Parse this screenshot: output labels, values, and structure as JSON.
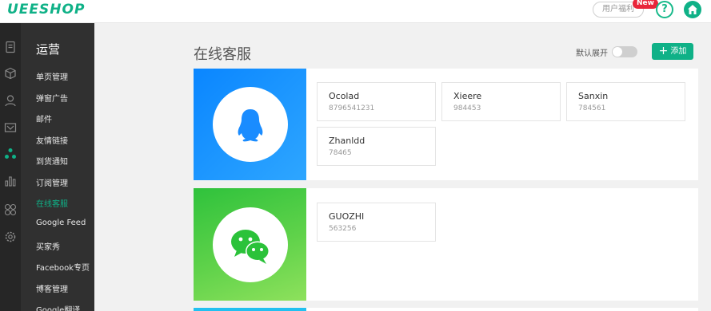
{
  "header": {
    "logo": "UEESHOP",
    "perk_label": "用户福利",
    "new_badge": "New",
    "help_label": "?"
  },
  "menu": {
    "title": "运营",
    "items": [
      {
        "label": "单页管理"
      },
      {
        "label": "弹窗广告"
      },
      {
        "label": "邮件"
      },
      {
        "label": "友情链接"
      },
      {
        "label": "到货通知"
      },
      {
        "label": "订阅管理"
      },
      {
        "label": "在线客服"
      },
      {
        "label": "Google Feed"
      },
      {
        "label": "买家秀"
      },
      {
        "label": "Facebook专页"
      },
      {
        "label": "博客管理"
      },
      {
        "label": "Google翻译"
      }
    ],
    "active_index": 6
  },
  "main": {
    "title": "在线客服",
    "toggle_label": "默认展开",
    "toggle_on": false,
    "add_label": "添加",
    "qq": {
      "accounts": [
        {
          "name": "Ocolad",
          "account": "8796541231"
        },
        {
          "name": "Xieere",
          "account": "984453"
        },
        {
          "name": "Sanxin",
          "account": "784561"
        },
        {
          "name": "Zhanldd",
          "account": "78465"
        }
      ]
    },
    "wechat": {
      "accounts": [
        {
          "name": "GUOZHI",
          "account": "563256"
        }
      ]
    }
  },
  "colors": {
    "brand": "#0fb187",
    "qq_gradient": [
      "#0e8bff",
      "#28a4ff"
    ],
    "wechat_gradient": [
      "#38c53a",
      "#8ae05a"
    ],
    "skype": "#22c0f0"
  }
}
